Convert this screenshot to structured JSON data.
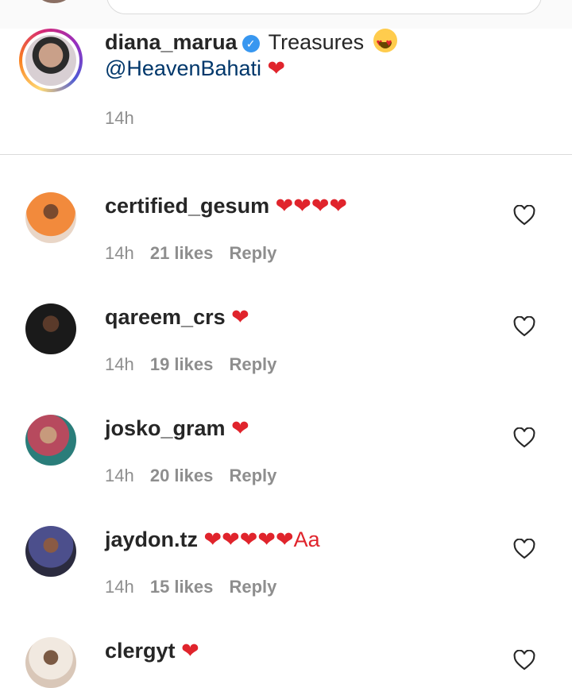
{
  "caption": {
    "username": "diana_marua",
    "text": "Treasures",
    "mention": "@HeavenBahati",
    "emoji_heart": "❤",
    "time": "14h"
  },
  "comments": [
    {
      "username": "certified_gesum",
      "text": "❤❤❤❤",
      "time": "14h",
      "likes": "21 likes",
      "reply": "Reply",
      "avatar_color": "#f28a3c"
    },
    {
      "username": "qareem_crs",
      "text": "❤",
      "time": "14h",
      "likes": "19 likes",
      "reply": "Reply",
      "avatar_color": "#1a1a1a"
    },
    {
      "username": "josko_gram",
      "text": "❤",
      "time": "14h",
      "likes": "20 likes",
      "reply": "Reply",
      "avatar_color": "#b74a5e"
    },
    {
      "username": "jaydon.tz",
      "text": "❤❤❤❤❤Aa",
      "time": "14h",
      "likes": "15 likes",
      "reply": "Reply",
      "avatar_color": "#4c4f8c"
    },
    {
      "username": "clergyt",
      "text": "❤",
      "time": "",
      "likes": "",
      "reply": "",
      "avatar_color": "#d9c7b8"
    }
  ],
  "colors": {
    "heart": "#e0242c",
    "mention": "#00376b",
    "meta": "#8e8e8e",
    "verified": "#3897f0"
  }
}
